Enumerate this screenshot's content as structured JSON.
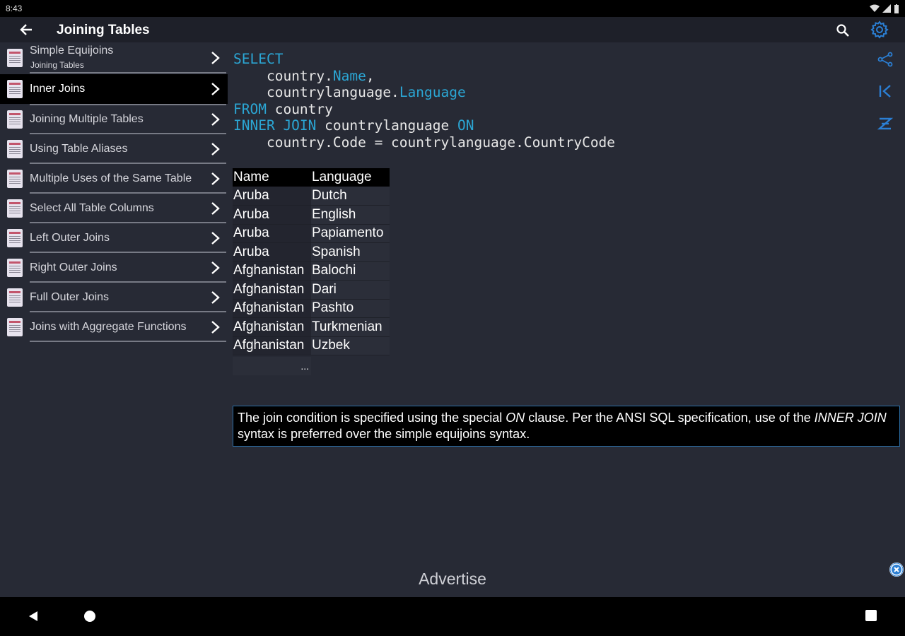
{
  "status": {
    "time": "8:43"
  },
  "app": {
    "title": "Joining Tables"
  },
  "sidebar": {
    "items": [
      {
        "label": "Simple Equijoins",
        "sub": "Joining Tables"
      },
      {
        "label": "Inner Joins",
        "active": true
      },
      {
        "label": "Joining Multiple Tables"
      },
      {
        "label": "Using Table Aliases"
      },
      {
        "label": "Multiple Uses of the Same Table"
      },
      {
        "label": "Select All Table Columns"
      },
      {
        "label": "Left Outer Joins"
      },
      {
        "label": "Right Outer Joins"
      },
      {
        "label": "Full Outer Joins"
      },
      {
        "label": "Joins with Aggregate Functions"
      }
    ]
  },
  "code": {
    "select": "SELECT",
    "line2_a": "    country.",
    "line2_b": "Name",
    "line2_c": ",",
    "line3_a": "    countrylanguage.",
    "line3_b": "Language",
    "from": "FROM",
    "from_rest": " country",
    "inner_join": "INNER JOIN",
    "join_rest": " countrylanguage ",
    "on": "ON",
    "line6": "    country.Code = countrylanguage.CountryCode"
  },
  "table": {
    "headers": [
      "Name",
      "Language"
    ],
    "rows": [
      [
        "Aruba",
        "Dutch"
      ],
      [
        "Aruba",
        "English"
      ],
      [
        "Aruba",
        "Papiamento"
      ],
      [
        "Aruba",
        "Spanish"
      ],
      [
        "Afghanistan",
        "Balochi"
      ],
      [
        "Afghanistan",
        "Dari"
      ],
      [
        "Afghanistan",
        "Pashto"
      ],
      [
        "Afghanistan",
        "Turkmenian"
      ],
      [
        "Afghanistan",
        "Uzbek"
      ]
    ],
    "ellipsis": "..."
  },
  "note": {
    "part1": "The join condition is specified using the special ",
    "em1": "ON",
    "part2": " clause. Per the ANSI SQL specification, use of the ",
    "em2": "INNER JOIN",
    "part3": " syntax is preferred over the simple equijoins syntax."
  },
  "ad": {
    "label": "Advertise"
  },
  "colors": {
    "keyword": "#2ba6d4",
    "accent": "#2b7fd4",
    "background": "#272a35"
  },
  "icons": [
    "back-arrow-icon",
    "search-icon",
    "gear-icon",
    "share-icon",
    "first-page-icon",
    "sort-icon",
    "close-icon"
  ]
}
